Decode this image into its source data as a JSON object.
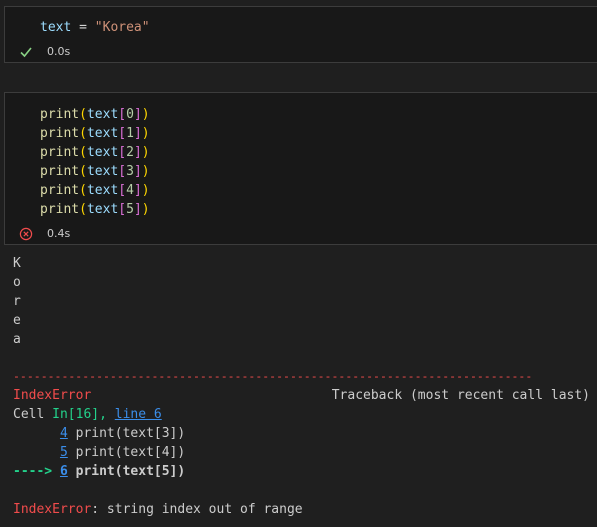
{
  "cell1": {
    "code": {
      "var": "text",
      "op": " = ",
      "str": "\"Korea\""
    },
    "status_time": "0.0s",
    "status_icon": "check-icon",
    "status_color": "#89d185"
  },
  "cell2": {
    "lines": [
      {
        "fn": "print",
        "var": "text",
        "idx": "0"
      },
      {
        "fn": "print",
        "var": "text",
        "idx": "1"
      },
      {
        "fn": "print",
        "var": "text",
        "idx": "2"
      },
      {
        "fn": "print",
        "var": "text",
        "idx": "3"
      },
      {
        "fn": "print",
        "var": "text",
        "idx": "4"
      },
      {
        "fn": "print",
        "var": "text",
        "idx": "5"
      }
    ],
    "status_time": "0.4s",
    "status_icon": "error-circle-icon",
    "status_color": "#f14c4c"
  },
  "output": {
    "chars": [
      "K",
      "o",
      "r",
      "e",
      "a"
    ],
    "dashes": "---------------------------------------------------------------------------",
    "error_name": "IndexError",
    "traceback_header": "Traceback (most recent call last)",
    "cell_prefix": "Cell ",
    "cell_ref": "In[16]",
    "cell_sep": ", ",
    "line_ref": "line 6",
    "tb_lines": [
      {
        "prefix": "      ",
        "num": "4",
        "code": " print(text[3])",
        "bold": false
      },
      {
        "prefix": "      ",
        "num": "5",
        "code": " print(text[4])",
        "bold": false
      },
      {
        "prefix": "----> ",
        "num": "6",
        "code": " print(text[5])",
        "bold": true
      }
    ],
    "final_error_name": "IndexError",
    "final_error_msg": ": string index out of range"
  }
}
